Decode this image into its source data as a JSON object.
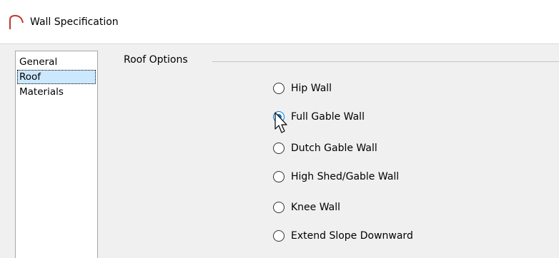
{
  "window": {
    "title": "Wall Specification"
  },
  "nav": {
    "items": [
      "General",
      "Roof",
      "Materials"
    ],
    "selected": "Roof"
  },
  "group": {
    "label": "Roof Options"
  },
  "options": [
    {
      "label": "Hip Wall",
      "checked": false
    },
    {
      "label": "Full Gable Wall",
      "checked": true
    },
    {
      "label": "Dutch Gable Wall",
      "checked": false
    },
    {
      "label": "High Shed/Gable Wall",
      "checked": false
    },
    {
      "label": "Knee Wall",
      "checked": false
    },
    {
      "label": "Extend Slope Downward",
      "checked": false
    }
  ],
  "colors": {
    "accent": "#0078d7",
    "selection": "#cce8ff",
    "icon": "#c0392b"
  },
  "icons": {
    "app": "roof-arch-icon",
    "pointer": "mouse-pointer-icon"
  }
}
